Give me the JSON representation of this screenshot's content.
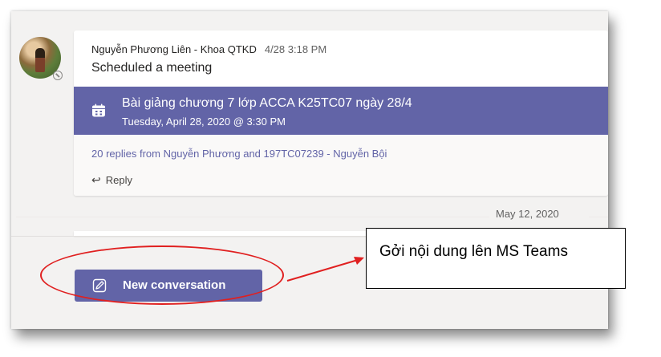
{
  "post": {
    "author": "Nguyễn Phương Liên - Khoa QTKD",
    "time": "4/28 3:18 PM",
    "subject": "Scheduled a meeting",
    "meeting": {
      "title": "Bài giảng chương 7 lớp ACCA K25TC07 ngày 28/4",
      "date": "Tuesday, April 28, 2020 @ 3:30 PM"
    },
    "replies": "20 replies from Nguyễn Phương and 197TC07239 - Nguyễn Bội",
    "reply_label": "Reply"
  },
  "date_separator": "May 12, 2020",
  "compose": {
    "new_conversation_label": "New conversation"
  },
  "annotation": {
    "callout_text": "Gởi nội dung lên MS Teams",
    "color": "#e02020"
  },
  "colors": {
    "accent": "#6264a7",
    "background": "#f3f2f1"
  },
  "icons": {
    "meeting": "calendar-icon",
    "reply": "reply-arrow-icon",
    "compose": "edit-icon",
    "status": "offline-status-icon"
  }
}
